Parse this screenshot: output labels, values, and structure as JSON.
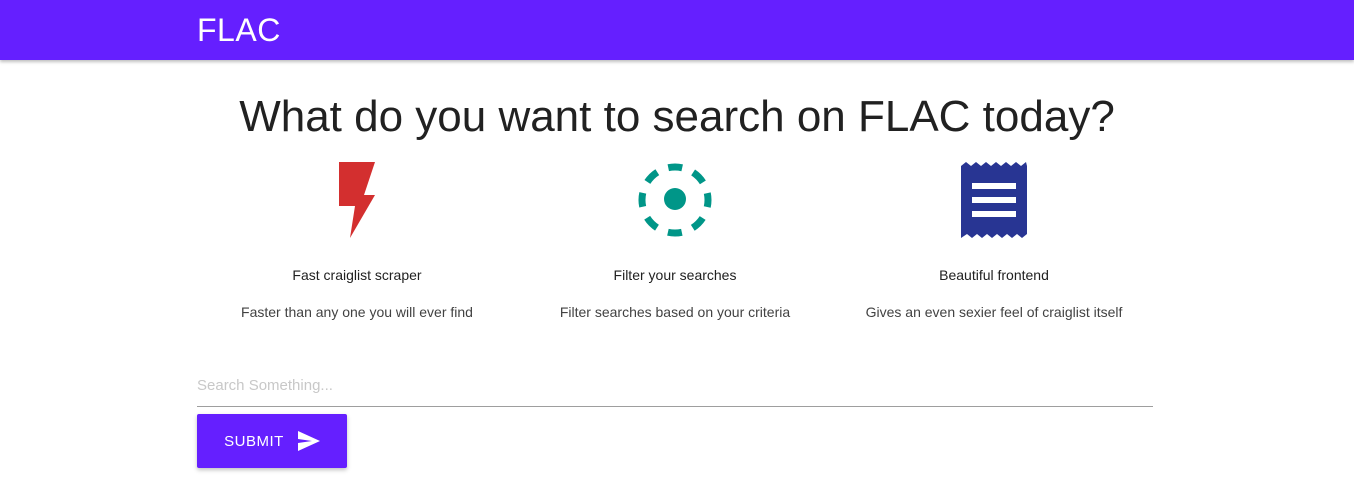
{
  "navbar": {
    "brand": "FLAC",
    "color": "#651fff"
  },
  "headline": "What do you want to search on FLAC today?",
  "features": [
    {
      "icon": "flash-icon",
      "icon_color": "#d32f2f",
      "title": "Fast craiglist scraper",
      "description": "Faster than any one you will ever find"
    },
    {
      "icon": "filter-center-focus-icon",
      "icon_color": "#009688",
      "title": "Filter your searches",
      "description": "Filter searches based on your criteria"
    },
    {
      "icon": "receipt-icon",
      "icon_color": "#283593",
      "title": "Beautiful frontend",
      "description": "Gives an even sexier feel of craiglist itself"
    }
  ],
  "search": {
    "placeholder": "Search Something...",
    "value": ""
  },
  "submit": {
    "label": "SUBMIT",
    "icon": "send-icon"
  }
}
